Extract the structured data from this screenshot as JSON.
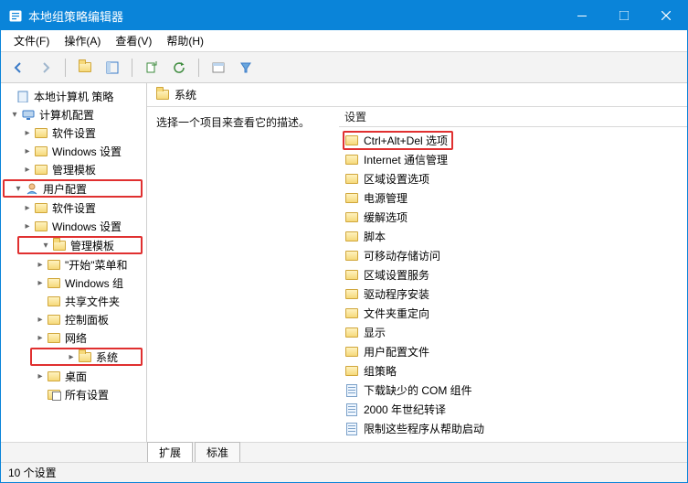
{
  "title": "本地组策略编辑器",
  "menus": {
    "file": "文件(F)",
    "action": "操作(A)",
    "view": "查看(V)",
    "help": "帮助(H)"
  },
  "tree": {
    "root": "本地计算机 策略",
    "computer": "计算机配置",
    "c_soft": "软件设置",
    "c_win": "Windows 设置",
    "c_admin": "管理模板",
    "user": "用户配置",
    "u_soft": "软件设置",
    "u_win": "Windows 设置",
    "u_admin": "管理模板",
    "u_start": "\"开始\"菜单和",
    "u_wincomp": "Windows 组",
    "u_share": "共享文件夹",
    "u_ctrl": "控制面板",
    "u_net": "网络",
    "u_sys": "系统",
    "u_desk": "桌面",
    "u_all": "所有设置"
  },
  "right": {
    "heading": "系统",
    "desc": "选择一个项目来查看它的描述。",
    "column": "设置",
    "items": [
      {
        "t": "Ctrl+Alt+Del 选项",
        "k": "folder",
        "hl": true
      },
      {
        "t": "Internet 通信管理",
        "k": "folder"
      },
      {
        "t": "区域设置选项",
        "k": "folder"
      },
      {
        "t": "电源管理",
        "k": "folder"
      },
      {
        "t": "缓解选项",
        "k": "folder"
      },
      {
        "t": "脚本",
        "k": "folder"
      },
      {
        "t": "可移动存储访问",
        "k": "folder"
      },
      {
        "t": "区域设置服务",
        "k": "folder"
      },
      {
        "t": "驱动程序安装",
        "k": "folder"
      },
      {
        "t": "文件夹重定向",
        "k": "folder"
      },
      {
        "t": "显示",
        "k": "folder"
      },
      {
        "t": "用户配置文件",
        "k": "folder"
      },
      {
        "t": "组策略",
        "k": "folder"
      },
      {
        "t": "下载缺少的 COM 组件",
        "k": "sheet"
      },
      {
        "t": "2000 年世纪转译",
        "k": "sheet"
      },
      {
        "t": "限制这些程序从帮助启动",
        "k": "sheet"
      }
    ]
  },
  "tabs": {
    "ext": "扩展",
    "std": "标准"
  },
  "status": "10 个设置"
}
